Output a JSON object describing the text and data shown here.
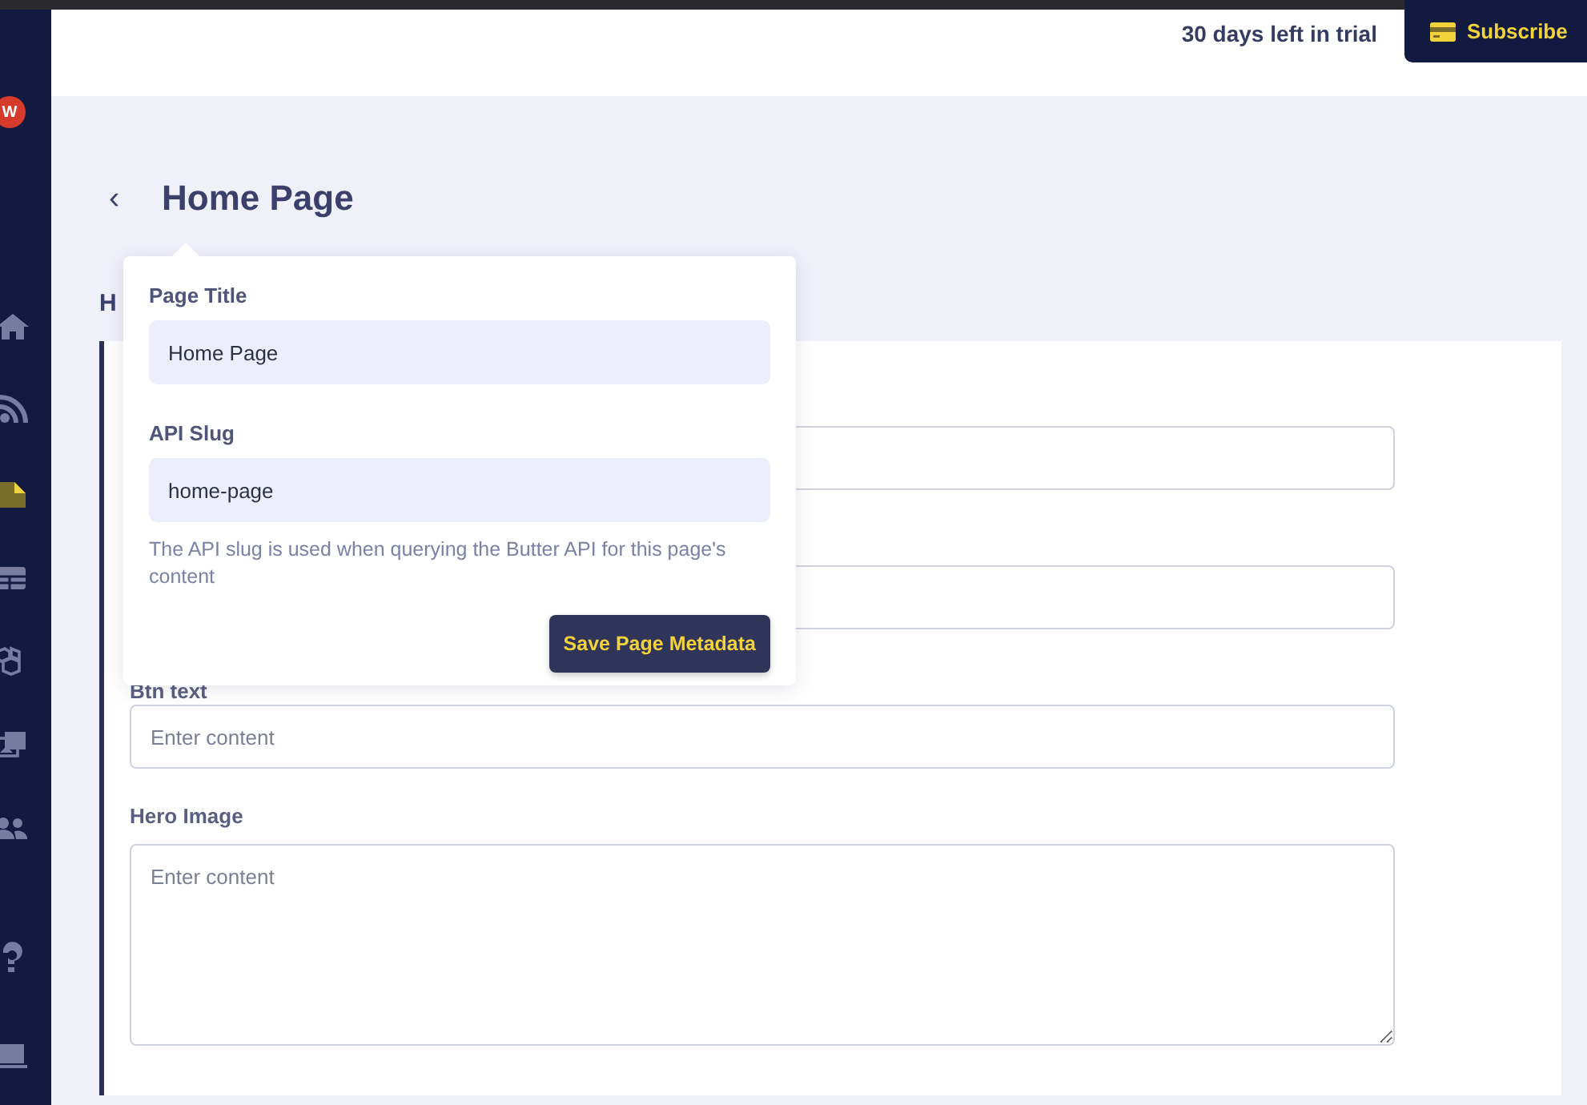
{
  "sidebar": {
    "avatar": "W",
    "items": [
      {
        "kind": "home",
        "selected": false
      },
      {
        "kind": "feed",
        "selected": false
      },
      {
        "kind": "page",
        "selected": true
      },
      {
        "kind": "table",
        "selected": false
      },
      {
        "kind": "cubes",
        "selected": false
      },
      {
        "kind": "images",
        "selected": false
      },
      {
        "kind": "users",
        "selected": false
      },
      {
        "kind": "help",
        "selected": false
      },
      {
        "kind": "laptop",
        "selected": false
      }
    ]
  },
  "topbar": {
    "trial": "30 days left in trial",
    "subscribe": "Subscribe"
  },
  "page": {
    "back": "‹",
    "title": "Home Page",
    "section": "H"
  },
  "fields": [
    {
      "kind": "input"
    },
    {
      "kind": "input"
    },
    {
      "kind": "input",
      "label": "Btn text",
      "placeholder": "Enter content"
    },
    {
      "kind": "textarea",
      "label": "Hero Image",
      "placeholder": "Enter content"
    }
  ],
  "popover": {
    "title_label": "Page Title",
    "title_value": "Home Page",
    "slug_label": "API Slug",
    "slug_value": "home-page",
    "help": "The API slug is used when querying the Butter API for this page's content",
    "button": "Save Page Metadata"
  }
}
